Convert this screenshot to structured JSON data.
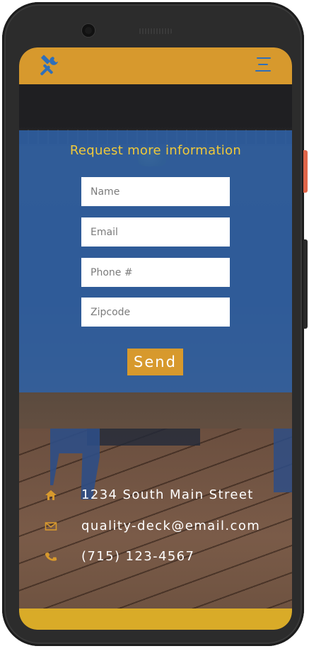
{
  "header": {
    "logo_icon": "tools-icon",
    "menu_icon": "hamburger-menu-icon",
    "bar_color": "#d7992d",
    "icon_color": "#2f6fb9"
  },
  "form": {
    "title": "Request more information",
    "fields": {
      "name_placeholder": "Name",
      "email_placeholder": "Email",
      "phone_placeholder": "Phone #",
      "zipcode_placeholder": "Zipcode"
    },
    "send_label": "Send",
    "panel_color": "#2f62a8",
    "title_color": "#f0c93a"
  },
  "contact": {
    "address": "1234 South Main Street",
    "email": "quality-deck@email.com",
    "phone": "(715) 123-4567",
    "icons": [
      "home-icon",
      "envelope-icon",
      "phone-icon"
    ],
    "icon_color": "#d7992d"
  },
  "footer": {
    "bar_color": "#d9ab28"
  }
}
